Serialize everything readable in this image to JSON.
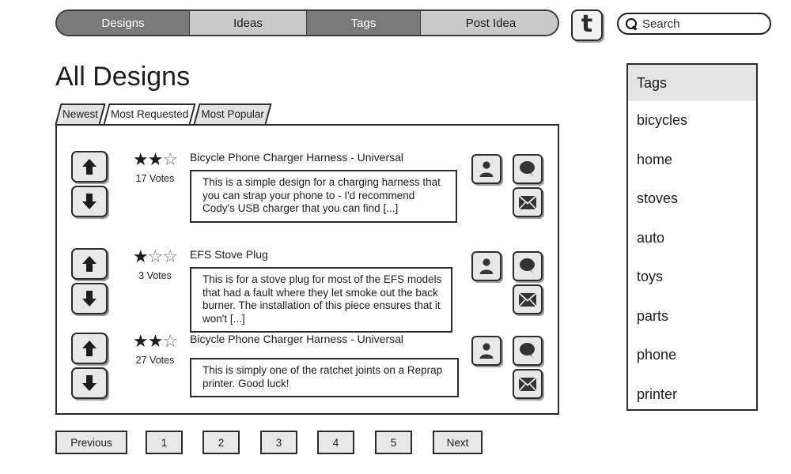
{
  "nav": {
    "tabs": [
      {
        "label": "Designs",
        "state": "selected"
      },
      {
        "label": "Ideas",
        "state": "unselected"
      },
      {
        "label": "Tags",
        "state": "selected"
      },
      {
        "label": "Post Idea",
        "state": "unselected"
      }
    ],
    "twitter_icon": "twitter-bird-icon",
    "twitter_glyph": "t"
  },
  "search": {
    "icon": "search-icon",
    "placeholder": "Search",
    "value": "Search"
  },
  "page": {
    "title": "All Designs"
  },
  "subtabs": [
    {
      "label": "Newest",
      "active": false
    },
    {
      "label": "Most Requested",
      "active": true
    },
    {
      "label": "Most Popular",
      "active": false
    }
  ],
  "list": {
    "items": [
      {
        "title": "Bicycle Phone Charger Harness - Universal",
        "stars_filled": 2,
        "stars_total": 3,
        "stars_display": "★★",
        "stars_empty_display": "☆",
        "votes": "17 Votes",
        "description": "This is a simple design for a charging harness that you can strap your phone to - I'd recommend Cody's USB charger that you can find [...]",
        "upvote_icon": "arrow-up-icon",
        "downvote_icon": "arrow-down-icon",
        "actions": [
          "user-icon",
          "comment-icon",
          "mail-icon"
        ]
      },
      {
        "title": "EFS Stove Plug",
        "stars_filled": 1,
        "stars_total": 3,
        "stars_display": "★",
        "stars_empty_display": "☆☆",
        "votes": "3 Votes",
        "description": "This is for a stove plug for most of the EFS models that had a fault where they let smoke out the back burner. The installation of this piece ensures that it won't [...]",
        "upvote_icon": "arrow-up-icon",
        "downvote_icon": "arrow-down-icon",
        "actions": [
          "user-icon",
          "comment-icon",
          "mail-icon"
        ]
      },
      {
        "title": "Bicycle Phone Charger Harness - Universal",
        "stars_filled": 2,
        "stars_total": 3,
        "stars_display": "★★",
        "stars_empty_display": "☆",
        "votes": "27 Votes",
        "description": "This is simply one of the ratchet joints on a Reprap printer. Good luck!",
        "upvote_icon": "arrow-up-icon",
        "downvote_icon": "arrow-down-icon",
        "actions": [
          "user-icon",
          "comment-icon",
          "mail-icon"
        ]
      }
    ]
  },
  "tags_panel": {
    "header": "Tags",
    "items": [
      "bicycles",
      "home",
      "stoves",
      "auto",
      "toys",
      "parts",
      "phone",
      "printer"
    ]
  },
  "pagination": {
    "previous": "Previous",
    "pages": [
      "1",
      "2",
      "3",
      "4",
      "5"
    ],
    "next": "Next"
  },
  "colors": {
    "selected_tab": "#7a7a7a",
    "unselected_tab": "#c9c9c9",
    "outline": "#2b2b2b",
    "button_face": "#e8e8e8",
    "header_face": "#e4e4e4"
  }
}
